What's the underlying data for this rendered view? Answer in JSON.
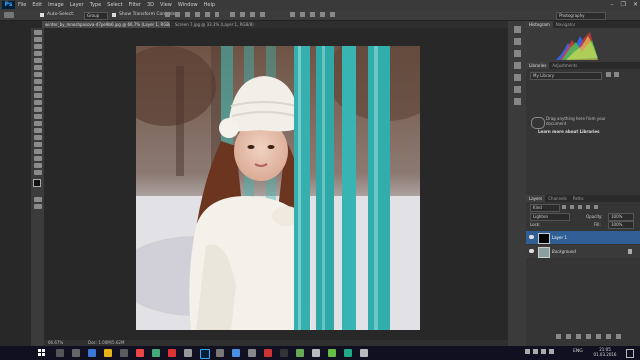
{
  "app": {
    "logo": "Ps"
  },
  "menu": [
    "File",
    "Edit",
    "Image",
    "Layer",
    "Type",
    "Select",
    "Filter",
    "3D",
    "View",
    "Window",
    "Help"
  ],
  "window_controls": [
    "–",
    "❐",
    "✕"
  ],
  "options": {
    "auto_select": "Auto-Select:",
    "group": "Group",
    "show_transform": "Show Transform Controls",
    "workspace": "Photography"
  },
  "tabs": [
    {
      "label": "winter_by_mnoshpasova-d7pe9b6.jpg @ 66.7% (Layer 1, RGB/8) *"
    },
    {
      "label": "Screen 7.jpg @ 33.3% (Layer 1, RGB/8)"
    }
  ],
  "status": {
    "zoom": "66.67%",
    "doc": "Doc: 1.00M/5.62M"
  },
  "panels": {
    "histogram_tabs": [
      "Histogram",
      "Navigator"
    ],
    "libraries_tabs": [
      "Libraries",
      "Adjustments"
    ],
    "library_select": "My Library",
    "libraries_msg": "Drag anything here from your document",
    "libraries_link": "Learn more about Libraries",
    "layers_tabs": [
      "Layers",
      "Channels",
      "Paths"
    ],
    "kind": "Kind",
    "blend_mode": "Lighten",
    "opacity_label": "Opacity:",
    "opacity": "100%",
    "lock_label": "Lock:",
    "fill_label": "Fill:",
    "fill": "100%",
    "layers": [
      {
        "name": "Layer 1",
        "selected": true
      },
      {
        "name": "Background",
        "locked": true
      }
    ]
  },
  "taskbar": {
    "lang": "ENG",
    "time": "21:05",
    "date": "01.03.2016"
  },
  "colors": {
    "accent": "#31a8ff",
    "panel": "#353535",
    "canvas": "#282828",
    "fence": "#38b5b3",
    "selected_layer": "#2f5f94"
  }
}
